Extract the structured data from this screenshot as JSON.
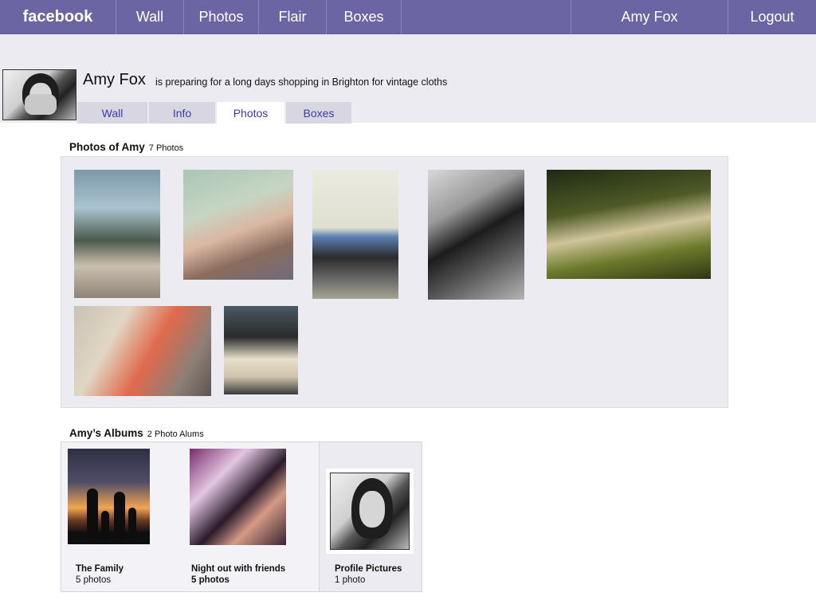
{
  "topbar": {
    "logo": "facebook",
    "nav": [
      "Wall",
      "Photos",
      "Flair",
      "Boxes"
    ],
    "user": "Amy Fox",
    "logout": "Logout"
  },
  "profile": {
    "name": "Amy Fox",
    "status": "is preparing for a long days shopping in Brighton for vintage cloths"
  },
  "tabs": [
    {
      "label": "Wall"
    },
    {
      "label": "Info"
    },
    {
      "label": "Photos",
      "active": true
    },
    {
      "label": "Boxes"
    }
  ],
  "photos": {
    "title": "Photos of Amy",
    "count": "7 Photos"
  },
  "albums": {
    "title": "Amy’s Albums",
    "count": "2 Photo Alums",
    "items": [
      {
        "name": "The Family",
        "count": "5 photos"
      },
      {
        "name": "Night out with friends",
        "count": "5 photos"
      },
      {
        "name": "Profile Pictures",
        "count": "1 photo"
      }
    ]
  },
  "colors": {
    "topbar": "#6b66a3",
    "band": "#ebebf1",
    "tab_text": "#3b3bb0"
  }
}
